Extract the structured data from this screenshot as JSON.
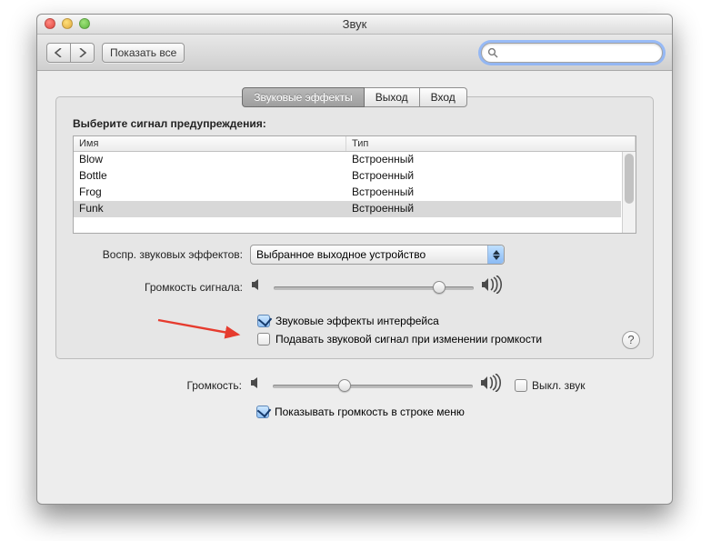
{
  "window": {
    "title": "Звук"
  },
  "toolbar": {
    "back_aria": "Назад",
    "forward_aria": "Вперед",
    "show_all": "Показать все",
    "search_placeholder": ""
  },
  "tabs": {
    "effects": "Звуковые эффекты",
    "output": "Выход",
    "input": "Вход"
  },
  "alerts": {
    "choose_label": "Выберите сигнал предупреждения:",
    "col_name": "Имя",
    "col_type": "Тип",
    "rows": [
      {
        "name": "Blow",
        "type": "Встроенный"
      },
      {
        "name": "Bottle",
        "type": "Встроенный"
      },
      {
        "name": "Frog",
        "type": "Встроенный"
      },
      {
        "name": "Funk",
        "type": "Встроенный"
      }
    ],
    "selected_index": 3
  },
  "play_through": {
    "label": "Воспр. звуковых эффектов:",
    "value": "Выбранное выходное устройство"
  },
  "alert_volume_label": "Громкость сигнала:",
  "ui_effects_label": "Звуковые эффекты интерфейса",
  "feedback_label": "Подавать звуковой сигнал при изменении громкости",
  "help_symbol": "?",
  "main_volume_label": "Громкость:",
  "mute_label": "Выкл. звук",
  "show_in_menu_label": "Показывать громкость в строке меню"
}
